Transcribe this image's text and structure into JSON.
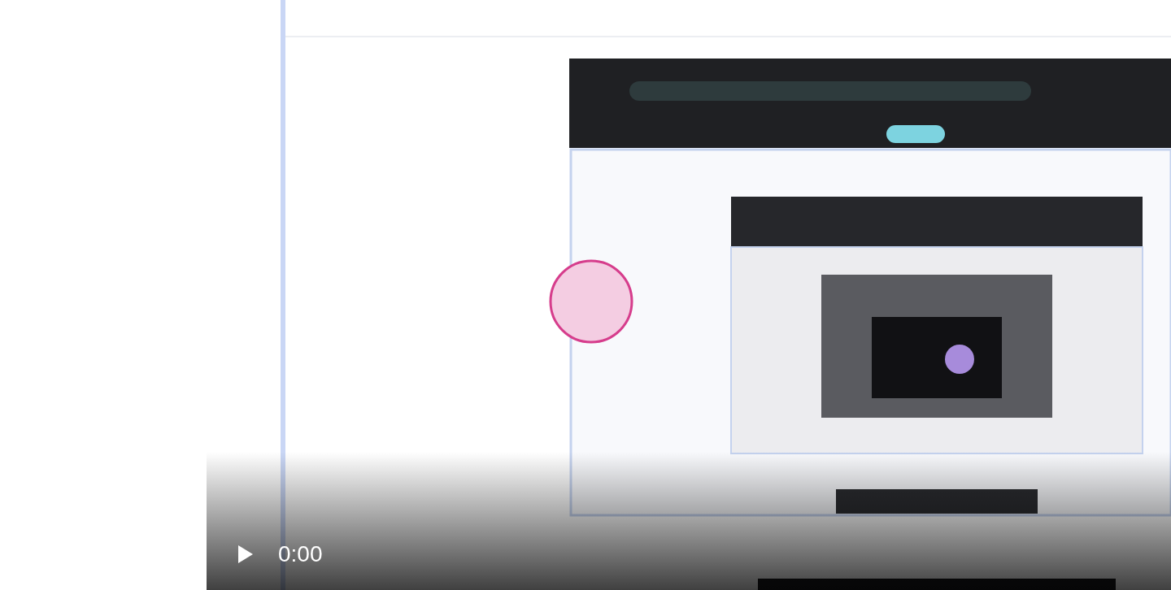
{
  "player": {
    "playing": false,
    "time": "0:00"
  }
}
